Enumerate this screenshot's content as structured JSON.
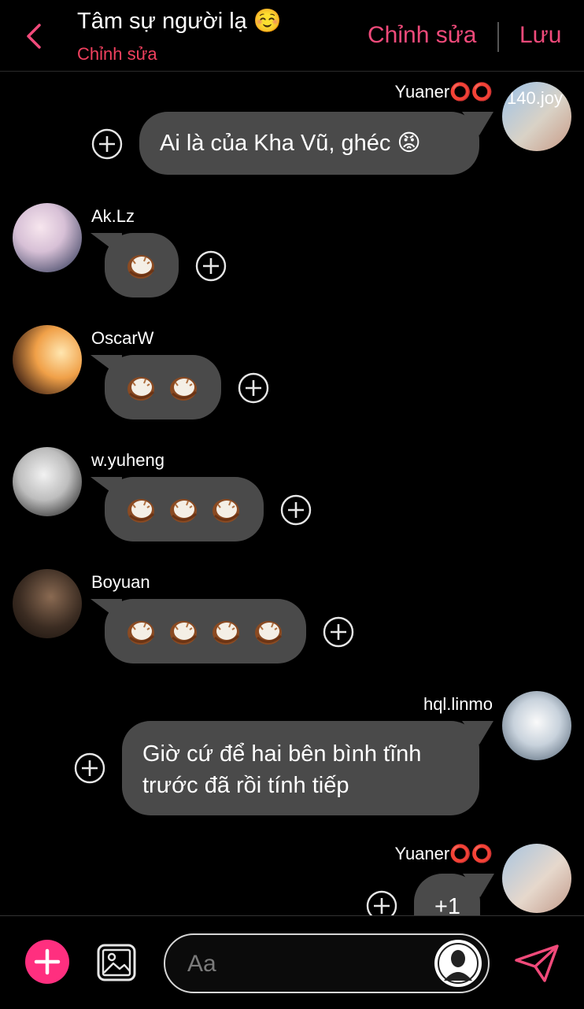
{
  "header": {
    "title": "Tâm sự người lạ ☺️",
    "subtitle": "Chỉnh sửa",
    "edit_label": "Chỉnh sửa",
    "save_label": "Lưu",
    "back_icon": "chevron-left-icon"
  },
  "messages": [
    {
      "sender": "Yuaner⭕⭕",
      "side": "right",
      "avatar_tag": "140.joy",
      "text": "Ai là của Kha Vũ, ghéc 😡"
    },
    {
      "sender": "Ak.Lz",
      "side": "left",
      "coconuts": 1
    },
    {
      "sender": "OscarW",
      "side": "left",
      "coconuts": 2
    },
    {
      "sender": "w.yuheng",
      "side": "left",
      "coconuts": 3
    },
    {
      "sender": "Boyuan",
      "side": "left",
      "coconuts": 4
    },
    {
      "sender": "hql.linmo",
      "side": "right",
      "text_line1": "Giờ cứ để hai bên bình tĩnh",
      "text_line2": "trước đã rồi tính tiếp"
    },
    {
      "sender": "Yuaner⭕⭕",
      "side": "right",
      "text": "+1"
    }
  ],
  "composer": {
    "placeholder": "Aa",
    "add_icon": "plus-icon",
    "image_icon": "image-icon",
    "send_icon": "send-icon"
  },
  "colors": {
    "accent": "#f04a7a",
    "subtitle": "#f0405e",
    "bubble": "#4a4a4a",
    "add_button": "#ff2f7f"
  }
}
